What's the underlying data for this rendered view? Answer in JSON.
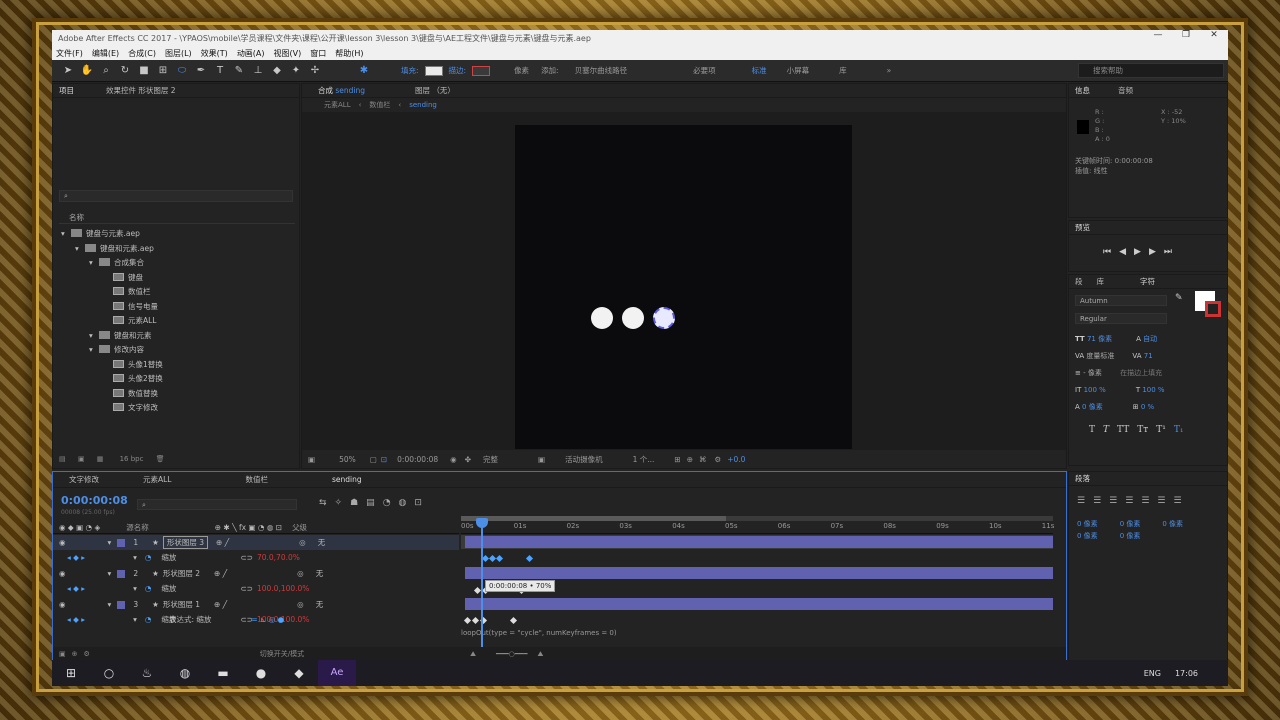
{
  "window": {
    "title": "Adobe After Effects CC 2017 - \\YPAOS\\mobile\\学员课程\\文件夹\\课程\\公开课\\lesson 3\\lesson 3\\键盘与\\AE工程文件\\键盘与元素\\键盘与元素.aep",
    "controls": [
      "—",
      "❐",
      "✕"
    ]
  },
  "menu": [
    "文件(F)",
    "编辑(E)",
    "合成(C)",
    "图层(L)",
    "效果(T)",
    "动画(A)",
    "视图(V)",
    "窗口",
    "帮助(H)"
  ],
  "toolbar": {
    "fill_label": "填充:",
    "stroke_label": "描边:",
    "px_label": "像素",
    "add_label": "添加:",
    "bezier_label": "贝塞尔曲线路径",
    "workspace_default": "必要项",
    "workspace_standard": "标准",
    "workspace_small": "小屏幕",
    "workspace_lib": "库",
    "more": "»",
    "search_placeholder": "搜索帮助"
  },
  "project": {
    "tab": "项目",
    "effects_tab": "效果控件 形状图层 2",
    "search_placeholder": "",
    "col_name": "名称",
    "tree": [
      {
        "label": "键盘与元素.aep",
        "indent": 0,
        "type": "folder"
      },
      {
        "label": "键盘和元素.aep",
        "indent": 1,
        "type": "folder"
      },
      {
        "label": "合成集合",
        "indent": 2,
        "type": "folder"
      },
      {
        "label": "键盘",
        "indent": 3,
        "type": "comp"
      },
      {
        "label": "数值栏",
        "indent": 3,
        "type": "comp"
      },
      {
        "label": "信号电量",
        "indent": 3,
        "type": "comp"
      },
      {
        "label": "元素ALL",
        "indent": 3,
        "type": "comp"
      },
      {
        "label": "键盘和元素",
        "indent": 2,
        "type": "folder"
      },
      {
        "label": "修改内容",
        "indent": 2,
        "type": "folder"
      },
      {
        "label": "头像1替换",
        "indent": 3,
        "type": "comp"
      },
      {
        "label": "头像2替换",
        "indent": 3,
        "type": "comp"
      },
      {
        "label": "数值替换",
        "indent": 3,
        "type": "comp"
      },
      {
        "label": "文字修改",
        "indent": 3,
        "type": "comp"
      }
    ],
    "bpc": "16 bpc"
  },
  "comp": {
    "tab": "合成",
    "tab_name": "sending",
    "layer_tab": "图层 （无）",
    "crumbs": [
      "元素ALL",
      "数值栏",
      "sending"
    ],
    "zoom": "50%",
    "timecode": "0:00:00:08",
    "resolution": "完整",
    "camera": "活动摄像机",
    "views": "1 个...",
    "offset": "+0.0"
  },
  "info": {
    "tab_info": "信息",
    "tab_audio": "音频",
    "r": "R :",
    "g": "G :",
    "b": "B :",
    "a": "A : 0",
    "x": "X : -52",
    "y": "Y : 10%",
    "kf_time": "关键帧时间: 0:00:00:08",
    "interp": "插值: 线性"
  },
  "preview": {
    "tab": "预览"
  },
  "character": {
    "tabs": [
      "段",
      "库",
      "字符"
    ],
    "font": "Autumn",
    "style": "Regular",
    "size": "71 像素",
    "leading": "自动",
    "kerning": "度量标准",
    "tracking": "71",
    "stroke": "- 像素",
    "stroke_type": "在描边上填充",
    "vscale": "100 %",
    "hscale": "100 %",
    "baseline": "0 像素",
    "tsume": "0 %"
  },
  "paragraph": {
    "tab": "段落",
    "indent_values": [
      "0 像素",
      "0 像素",
      "0 像素",
      "0 像素",
      "0 像素"
    ]
  },
  "timeline": {
    "tabs": [
      "文字修改",
      "元素ALL",
      "数值栏",
      "sending"
    ],
    "timecode": "0:00:00:08",
    "fps": "00008 (25.00 fps)",
    "col_name": "源名称",
    "col_parent": "父级",
    "layers": [
      {
        "num": "1",
        "name": "形状图层 3",
        "parent": "无",
        "prop": "缩放",
        "value": "70.0,70.0%"
      },
      {
        "num": "2",
        "name": "形状图层 2",
        "parent": "无",
        "prop": "缩放",
        "value": "100.0,100.0%"
      },
      {
        "num": "3",
        "name": "形状图层 1",
        "parent": "无",
        "prop": "缩放",
        "value": "100.0,100.0%"
      }
    ],
    "expr_label": "表达式: 缩放",
    "expression": "loopOut(type = \"cycle\", numKeyframes = 0)",
    "tooltip": "0:00:00:08 • 70%",
    "ruler": [
      "00s",
      "01s",
      "02s",
      "03s",
      "04s",
      "05s",
      "06s",
      "07s",
      "08s",
      "09s",
      "10s",
      "11s"
    ],
    "footer": "切换开关/模式"
  },
  "taskbar": {
    "time": "17:06",
    "lang": "ENG"
  }
}
